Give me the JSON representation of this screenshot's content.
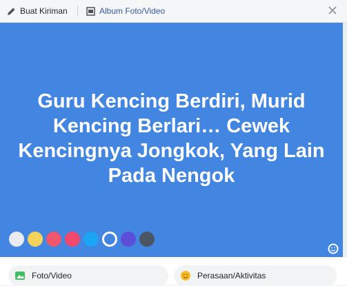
{
  "header": {
    "tabs": [
      {
        "label": "Buat Kiriman",
        "icon": "pencil-icon"
      },
      {
        "label": "Album Foto/Video",
        "icon": "photo-album-icon"
      }
    ],
    "close_icon": "close-icon"
  },
  "composer": {
    "text": "Guru Kencing Berdiri, Murid Kencing Berlari… Cewek Kencingnya Jongkok, Yang Lain Pada Nengok",
    "background_color": "#4286e1",
    "swatches": [
      {
        "color": "#e9ebee",
        "selected": false
      },
      {
        "color": "#f5d25a",
        "selected": false
      },
      {
        "color": "#f0566c",
        "selected": false
      },
      {
        "color": "#f2486e",
        "selected": false
      },
      {
        "color": "#1ca5f3",
        "selected": false
      },
      {
        "color": "#4286e1",
        "selected": true
      },
      {
        "color": "#5b4ed8",
        "selected": false
      },
      {
        "color": "#4b5563",
        "selected": false
      }
    ]
  },
  "actions": [
    {
      "label": "Foto/Video",
      "icon": "photo-icon"
    },
    {
      "label": "Perasaan/Aktivitas",
      "icon": "smiley-icon"
    }
  ]
}
